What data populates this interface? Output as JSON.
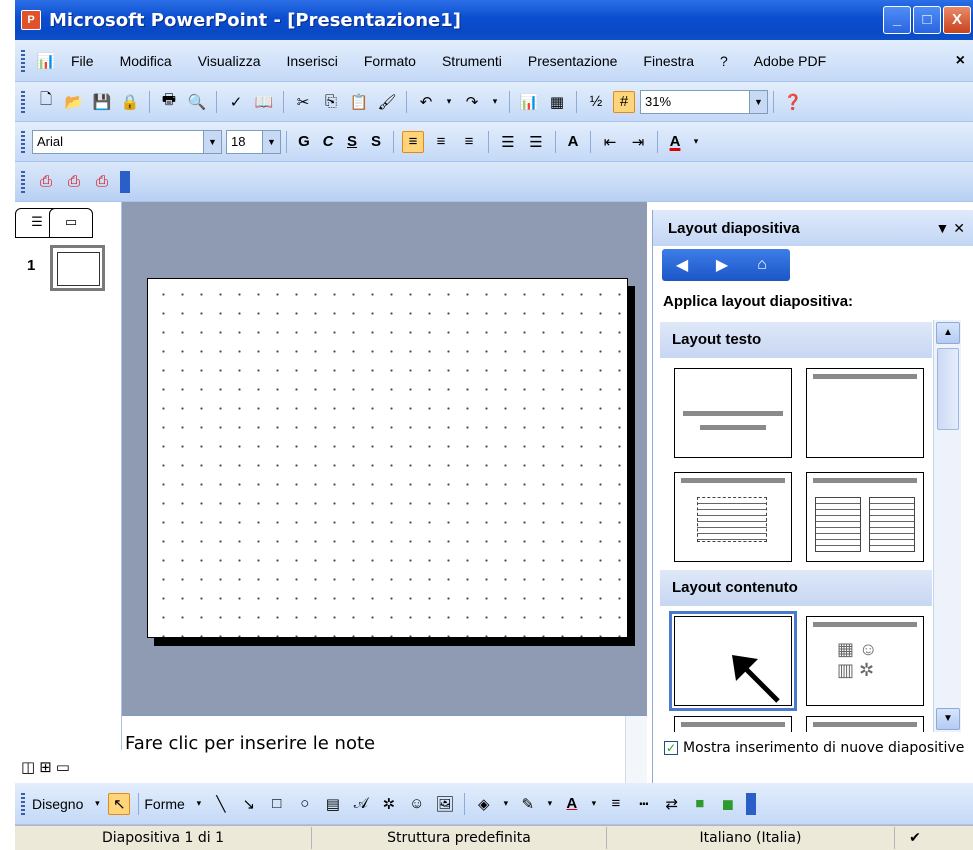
{
  "window": {
    "title": "Microsoft PowerPoint - [Presentazione1]",
    "controls": [
      "_",
      "□",
      "X"
    ]
  },
  "menu": {
    "items": [
      "File",
      "Modifica",
      "Visualizza",
      "Inserisci",
      "Formato",
      "Strumenti",
      "Presentazione",
      "Finestra",
      "?",
      "Adobe PDF"
    ],
    "close": "×"
  },
  "toolbar": {
    "zoom": "31%"
  },
  "format": {
    "font": "Arial",
    "size": "18",
    "bold": "G",
    "italic": "C",
    "underline": "S",
    "shadow": "S",
    "grow": "A",
    "fontcolor": "A"
  },
  "slides_pane": {
    "slide_number": "1"
  },
  "notes": {
    "placeholder": "Fare clic per inserire le note"
  },
  "taskpane": {
    "title": "Layout diapositiva",
    "apply_label": "Applica layout diapositiva:",
    "section_text": "Layout testo",
    "section_content": "Layout contenuto",
    "show_on_insert": "Mostra inserimento di nuove diapositive",
    "show_on_insert_checked": true
  },
  "drawing": {
    "draw_label": "Disegno",
    "shapes_label": "Forme"
  },
  "status": {
    "slide": "Diapositiva 1 di 1",
    "design": "Struttura predefinita",
    "language": "Italiano (Italia)"
  }
}
